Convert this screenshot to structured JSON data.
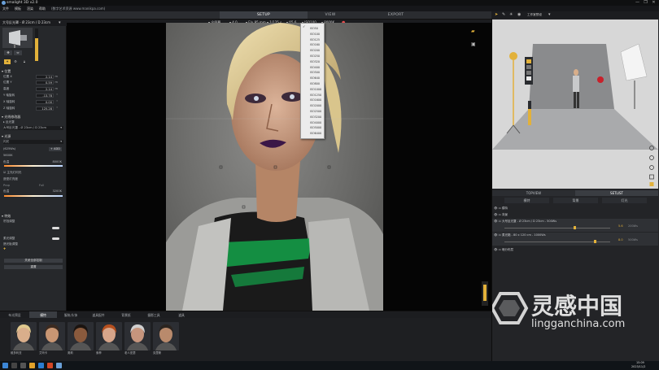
{
  "window": {
    "title": "smalight 3D v2.0",
    "controls": [
      "—",
      "❐",
      "✕"
    ]
  },
  "menu": {
    "items": [
      "文件",
      "模板",
      "渲染",
      "帮助"
    ],
    "extra": "(数字艺术资源 www.manikpa.com)"
  },
  "modes": {
    "setup": "SETUP",
    "view": "VIEW",
    "export": "EXPORT"
  },
  "toolbar2": {
    "light_name": "大号反光罩 - Ø 23cm / D 23cm",
    "style": "全屏幕",
    "aperture": "4.0",
    "focal": "F/x 95 mm",
    "shutter": "1/125 s",
    "fstop": "f/5.6",
    "iso": "ISO100",
    "wb": "8000K",
    "iso_display_label": "ISO100"
  },
  "right_header": {
    "render_quality": "Shooting (4/4) 5601 1920x1080",
    "preset": "工作室预设"
  },
  "iso_options": [
    "ISO50",
    "ISO100",
    "ISO125",
    "ISO160",
    "ISO200",
    "ISO250",
    "ISO320",
    "ISO400",
    "ISO500",
    "ISO640",
    "ISO800",
    "ISO1000",
    "ISO1250",
    "ISO1600",
    "ISO2000",
    "ISO2500",
    "ISO3200",
    "ISO4000",
    "ISO5000",
    "ISO6400"
  ],
  "iso_selected": "ISO50",
  "left": {
    "sec_position": "位置",
    "rows": [
      {
        "label": "位置 X",
        "value": "2.14",
        "unit": "m"
      },
      {
        "label": "位置 Y",
        "value": "0.59",
        "unit": "m"
      },
      {
        "label": "高度",
        "value": "2.14",
        "unit": "m"
      },
      {
        "label": "Y 轴旋转",
        "value": "-13.78",
        "unit": "°"
      },
      {
        "label": "X 轴旋转",
        "value": "0.00",
        "unit": "°"
      },
      {
        "label": "Z 轴旋转",
        "value": "125.28",
        "unit": "°"
      }
    ],
    "sec_modifier": "光线修改器",
    "modifier_label": "反光罩",
    "modifier_value": "大号反光罩 - Ø 23cm / D 23cm",
    "sec_light": "光源",
    "light_type": "闪光",
    "power": "(625Ws)",
    "add_label": "+ ADD",
    "color_temp": "5600K",
    "temp_label": "色温",
    "temp_max": "8000K",
    "flash_mode": "主光灯闪光",
    "fill_label": "造型灯亮度",
    "prop": "Prop",
    "full": "Full",
    "temp2_label": "色温",
    "temp2_max": "3200K",
    "sec_fx": "特效",
    "fx1": "帘挡调整",
    "fx2": "柔光调整",
    "fx3": "遮光板调整",
    "add_modifier_btn": "关闭全部控制",
    "reset_btn": "重置"
  },
  "bottom_tabs": [
    "布光预设",
    "模特",
    "服装/头饰",
    "道具配件",
    "背景纸",
    "摄影工具",
    "道具"
  ],
  "bottom_active": "模特",
  "models": [
    {
      "name": "维多利亚",
      "bg": "#2c2e33",
      "skin": "#d9ae8b",
      "hair": "#e0c98e"
    },
    {
      "name": "艾玛卡",
      "bg": "#2c2e33",
      "skin": "#c99673",
      "hair": "#3b2a20"
    },
    {
      "name": "奥莉",
      "bg": "#2c2e33",
      "skin": "#8a5a3d",
      "hair": "#1b1410"
    },
    {
      "name": "索菲",
      "bg": "#2c2e33",
      "skin": "#d7a58a",
      "hair": "#b6501f"
    },
    {
      "name": "老人亚瑟",
      "bg": "#2c2e33",
      "skin": "#c6957d",
      "hair": "#cfcfcf"
    },
    {
      "name": "克里斯",
      "bg": "#2c2e33",
      "skin": "#b98a6c",
      "hair": "#2a2420"
    }
  ],
  "right": {
    "tab_topview": "TOPVIEW",
    "tab_setlist": "SETLIST",
    "sub_tabs": [
      "模特",
      "背景",
      "灯光"
    ],
    "items": [
      {
        "label": "模特",
        "kind": "group"
      },
      {
        "label": "背景",
        "kind": "group"
      },
      {
        "label": "大号反光罩 - Ø 23cm / D 23cm - 500Ws",
        "kind": "light",
        "value": "5.6",
        "extra": "200Ws"
      },
      {
        "label": "柔光箱 - 80 x 120 cm - 1000Ws",
        "kind": "light",
        "value": "8.0",
        "extra": "500Ws"
      },
      {
        "label": "暗分布层",
        "kind": "group"
      }
    ]
  },
  "watermark": {
    "cn": "灵感中国",
    "en": "lingganchina.com"
  },
  "taskbar": {
    "time": "15:09",
    "date": "2023/11/2"
  },
  "colors": {
    "accent": "#e2b13a",
    "panel": "#26282b",
    "viewport": "#050505",
    "lipstick": "#3b1747",
    "shirt_green": "#14a34a"
  }
}
